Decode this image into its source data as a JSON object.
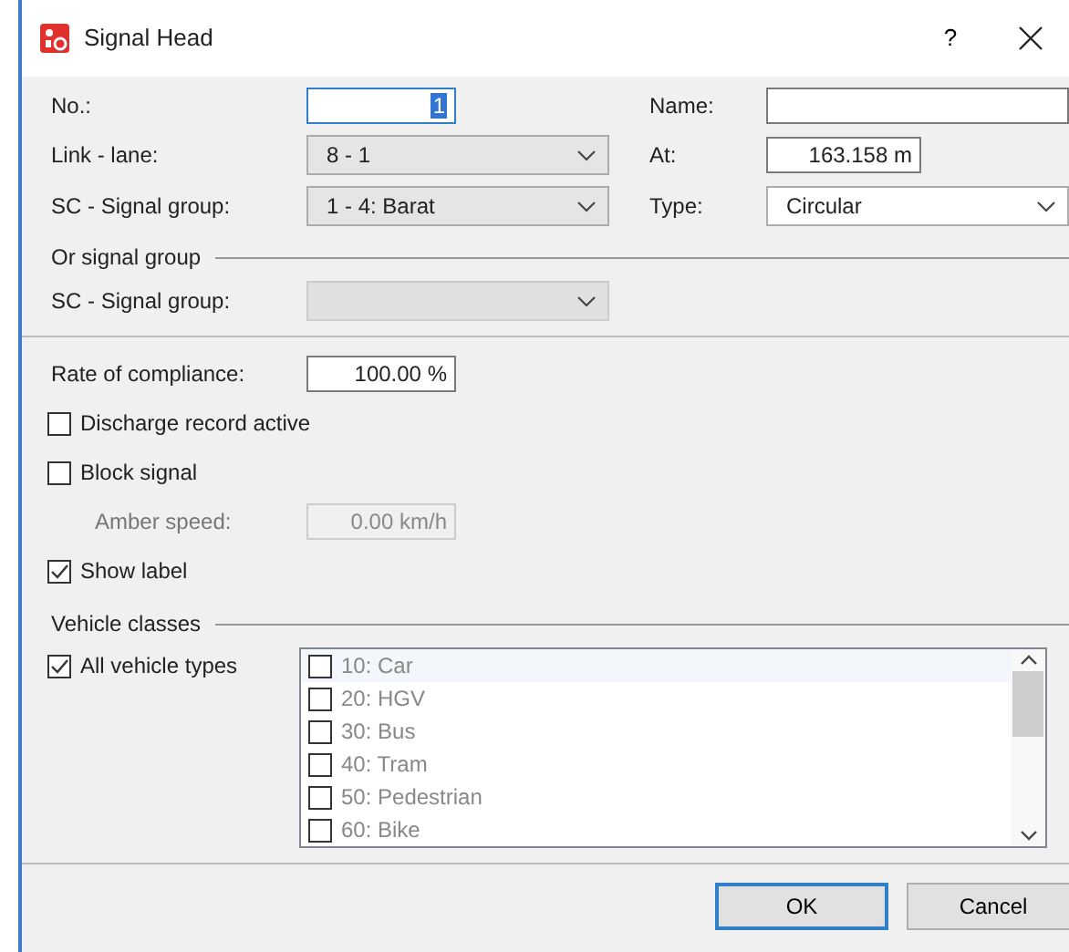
{
  "window": {
    "title": "Signal Head",
    "help": "?"
  },
  "fields": {
    "number": {
      "label": "No.:",
      "value": "1",
      "text_selected": true,
      "focused": true
    },
    "name": {
      "label": "Name:"
    },
    "link_lane": {
      "label": "Link - lane:",
      "value": "8 - 1",
      "disabled": false
    },
    "at": {
      "label": "At:",
      "value": "163.158 m"
    },
    "signal_group": {
      "label": "SC - Signal group:",
      "value": "1 - 4: Barat",
      "disabled": false
    },
    "type": {
      "label": "Type:",
      "value": "Circular",
      "disabled": false
    }
  },
  "or_signal_group": {
    "title": "Or signal group",
    "label": "SC - Signal group:",
    "disabled": true
  },
  "rate_of_compliance": {
    "label": "Rate of compliance:",
    "value": "100.00 %"
  },
  "discharge_record": {
    "label": "Discharge record active",
    "checked": false
  },
  "block_signal": {
    "label": "Block signal",
    "checked": false
  },
  "amber_speed": {
    "label": "Amber speed:",
    "value": "0.00 km/h",
    "disabled": true
  },
  "show_label": {
    "label": "Show label",
    "checked": true
  },
  "vehicle_classes": {
    "title": "Vehicle classes",
    "all_types": {
      "label": "All vehicle types",
      "checked": true
    },
    "list_disabled": true,
    "items": [
      {
        "label": "10: Car",
        "checked": false,
        "highlighted": true
      },
      {
        "label": "20: HGV",
        "checked": false,
        "highlighted": false
      },
      {
        "label": "30: Bus",
        "checked": false,
        "highlighted": false
      },
      {
        "label": "40: Tram",
        "checked": false,
        "highlighted": false
      },
      {
        "label": "50: Pedestrian",
        "checked": false,
        "highlighted": false
      },
      {
        "label": "60: Bike",
        "checked": false,
        "highlighted": false
      }
    ]
  },
  "buttons": [
    {
      "label": "OK",
      "default": true
    },
    {
      "label": "Cancel",
      "default": false
    }
  ]
}
